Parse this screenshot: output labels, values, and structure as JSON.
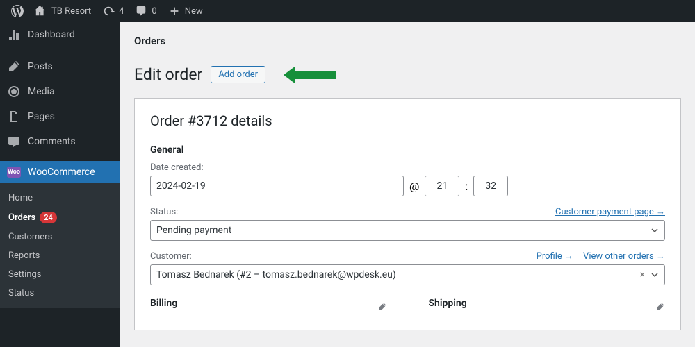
{
  "adminbar": {
    "site": "TB Resort",
    "updates": "4",
    "comments": "0",
    "new": "New"
  },
  "sidebar": {
    "dashboard": "Dashboard",
    "posts": "Posts",
    "media": "Media",
    "pages": "Pages",
    "comments": "Comments",
    "woocommerce": "WooCommerce",
    "sub": {
      "home": "Home",
      "orders": "Orders",
      "orders_badge": "24",
      "customers": "Customers",
      "reports": "Reports",
      "settings": "Settings",
      "status": "Status"
    }
  },
  "crumb": "Orders",
  "title": "Edit order",
  "add_order": "Add order",
  "panel_title": "Order #3712 details",
  "general": {
    "heading": "General",
    "date_label": "Date created:",
    "date": "2024-02-19",
    "at": "@",
    "hour": "21",
    "sep": ":",
    "minute": "32",
    "status_label": "Status:",
    "status_value": "Pending payment",
    "payment_page": "Customer payment page →",
    "customer_label": "Customer:",
    "profile": "Profile →",
    "view_orders": "View other orders →",
    "customer_value": "Tomasz Bednarek (#2 – tomasz.bednarek@wpdesk.eu)"
  },
  "billing": "Billing",
  "shipping": "Shipping"
}
